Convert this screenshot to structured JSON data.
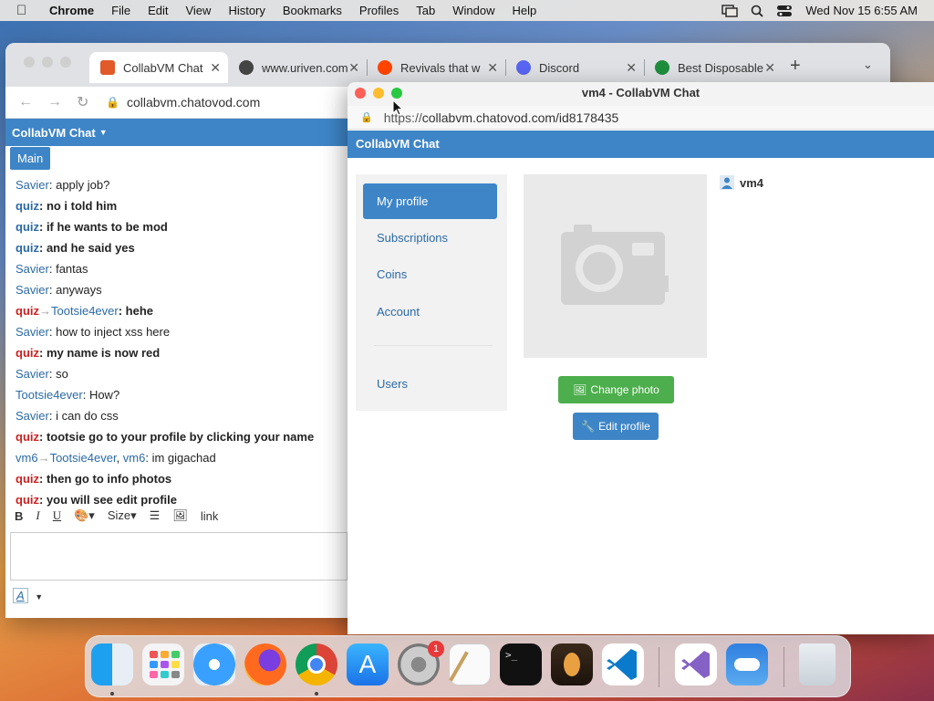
{
  "menubar": {
    "app": "Chrome",
    "items": [
      "File",
      "Edit",
      "View",
      "History",
      "Bookmarks",
      "Profiles",
      "Tab",
      "Window",
      "Help"
    ],
    "datetime": "Wed Nov 15  6:55 AM"
  },
  "tabs": [
    {
      "title": "CollabVM Chat",
      "color": "#e05a2a"
    },
    {
      "title": "www.uriven.com",
      "color": "#444444"
    },
    {
      "title": "Revivals that w",
      "color": "#ff4500"
    },
    {
      "title": "Discord",
      "color": "#5865f2"
    },
    {
      "title": "Best Disposable",
      "color": "#1e8e3e"
    }
  ],
  "browser": {
    "url": "collabvm.chatovod.com"
  },
  "chat": {
    "header": "CollabVM Chat",
    "room_tab": "Main",
    "messages": [
      {
        "parts": [
          {
            "t": "Savier",
            "c": "n-blue"
          },
          {
            "t": ": apply job?",
            "c": ""
          }
        ]
      },
      {
        "parts": [
          {
            "t": "quiz",
            "c": "n-blue bold"
          },
          {
            "t": ": no i told him",
            "c": "bold"
          }
        ]
      },
      {
        "parts": [
          {
            "t": "quiz",
            "c": "n-blue bold"
          },
          {
            "t": ": if he wants to be mod",
            "c": "bold"
          }
        ]
      },
      {
        "parts": [
          {
            "t": "quiz",
            "c": "n-blue bold"
          },
          {
            "t": ": and he said yes",
            "c": "bold"
          }
        ]
      },
      {
        "parts": [
          {
            "t": "Savier",
            "c": "n-blue"
          },
          {
            "t": ": fantas",
            "c": ""
          }
        ]
      },
      {
        "parts": [
          {
            "t": "Savier",
            "c": "n-blue"
          },
          {
            "t": ": anyways",
            "c": ""
          }
        ]
      },
      {
        "parts": [
          {
            "t": "quiz",
            "c": "n-red"
          },
          {
            "t": "→",
            "c": "arrow"
          },
          {
            "t": "Tootsie4ever",
            "c": "n-blue"
          },
          {
            "t": ": hehe",
            "c": "bold"
          }
        ]
      },
      {
        "parts": [
          {
            "t": "Savier",
            "c": "n-blue"
          },
          {
            "t": ": how to inject xss here",
            "c": ""
          }
        ]
      },
      {
        "parts": [
          {
            "t": "quiz",
            "c": "n-red"
          },
          {
            "t": ": my name is now red",
            "c": "bold"
          }
        ]
      },
      {
        "parts": [
          {
            "t": "Savier",
            "c": "n-blue"
          },
          {
            "t": ": so",
            "c": ""
          }
        ]
      },
      {
        "parts": [
          {
            "t": "Tootsie4ever",
            "c": "n-blue"
          },
          {
            "t": ": How?",
            "c": ""
          }
        ]
      },
      {
        "parts": [
          {
            "t": "Savier",
            "c": "n-blue"
          },
          {
            "t": ": i can do css",
            "c": ""
          }
        ]
      },
      {
        "parts": [
          {
            "t": "quiz",
            "c": "n-red"
          },
          {
            "t": ": tootsie go to your profile by clicking your name",
            "c": "bold"
          }
        ]
      },
      {
        "parts": [
          {
            "t": "vm6",
            "c": "n-blue"
          },
          {
            "t": "→",
            "c": "arrow"
          },
          {
            "t": "Tootsie4ever",
            "c": "n-blue"
          },
          {
            "t": ", ",
            "c": ""
          },
          {
            "t": "vm6",
            "c": "n-blue"
          },
          {
            "t": ": im gigachad",
            "c": ""
          }
        ]
      },
      {
        "parts": [
          {
            "t": "quiz",
            "c": "n-red"
          },
          {
            "t": ": then go to info photos",
            "c": "bold"
          }
        ]
      },
      {
        "parts": [
          {
            "t": "quiz",
            "c": "n-red"
          },
          {
            "t": ": you will see edit profile",
            "c": "bold"
          }
        ]
      }
    ],
    "toolbar": {
      "bold": "B",
      "italic": "I",
      "underline": "U",
      "size": "Size",
      "link": "link"
    },
    "format_icon": "A"
  },
  "popup": {
    "title": "vm4 - CollabVM Chat",
    "url_prefix": "https://",
    "url_rest": "collabvm.chatovod.com/id8178435",
    "header": "CollabVM Chat",
    "menu": {
      "my_profile": "My profile",
      "subscriptions": "Subscriptions",
      "coins": "Coins",
      "account": "Account",
      "users": "Users"
    },
    "change_photo": "Change photo",
    "edit_profile": "Edit profile",
    "username": "vm4"
  },
  "dock": {
    "apps": [
      "finder-icon",
      "launchpad-icon",
      "safari-icon",
      "firefox-icon",
      "chrome-icon",
      "app-store-icon",
      "system-settings-icon",
      "textedit-icon",
      "terminal-icon",
      "garageband-icon",
      "vscode-icon",
      "visual-studio-icon",
      "weather-icon",
      "trash-icon"
    ],
    "badge": "1"
  }
}
